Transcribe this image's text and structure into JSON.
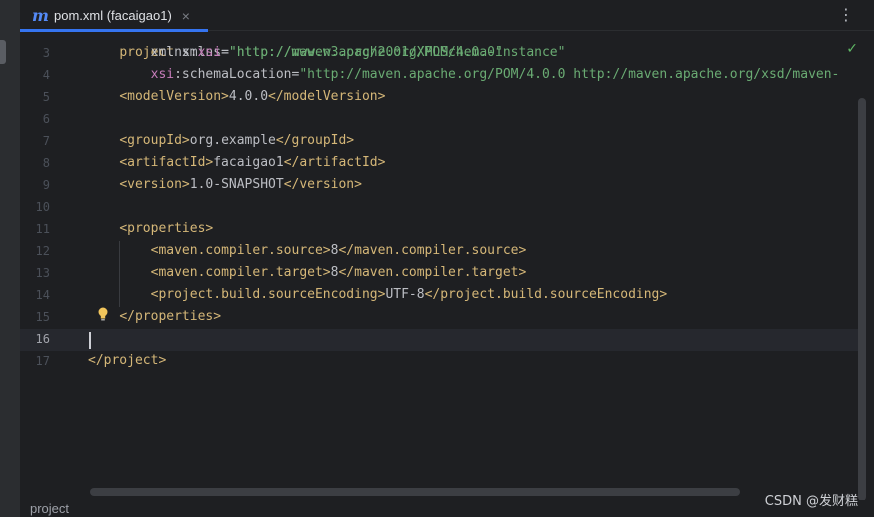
{
  "tab": {
    "icon": "maven-m-icon",
    "icon_glyph": "m",
    "title": "pom.xml (facaigao1)",
    "close_glyph": "×"
  },
  "toolbar": {
    "more_glyph": "⋮"
  },
  "status": {
    "check_glyph": "✓"
  },
  "editor": {
    "current_line": 16,
    "lines": [
      {
        "num": "3",
        "parts": [
          [
            "",
            "        "
          ],
          [
            "attr",
            "xmlns"
          ],
          [
            "",
            ":"
          ],
          [
            "ns",
            "xsi"
          ],
          [
            "",
            "="
          ],
          [
            "str",
            "\"http://www.w3.org/2001/XMLSchema-instance\""
          ]
        ]
      },
      {
        "num": "4",
        "parts": [
          [
            "",
            "        "
          ],
          [
            "ns",
            "xsi"
          ],
          [
            "attr",
            ":schemaLocation"
          ],
          [
            "",
            "="
          ],
          [
            "str",
            "\"http://maven.apache.org/POM/4.0.0 http://maven.apache.org/xsd/maven-"
          ]
        ]
      },
      {
        "num": "5",
        "parts": [
          [
            "",
            "    "
          ],
          [
            "tag",
            "<modelVersion>"
          ],
          [
            "txt",
            "4.0.0"
          ],
          [
            "tag",
            "</modelVersion>"
          ]
        ]
      },
      {
        "num": "6",
        "parts": []
      },
      {
        "num": "7",
        "parts": [
          [
            "",
            "    "
          ],
          [
            "tag",
            "<groupId>"
          ],
          [
            "txt",
            "org.example"
          ],
          [
            "tag",
            "</groupId>"
          ]
        ]
      },
      {
        "num": "8",
        "parts": [
          [
            "",
            "    "
          ],
          [
            "tag",
            "<artifactId>"
          ],
          [
            "txt",
            "facaigao1"
          ],
          [
            "tag",
            "</artifactId>"
          ]
        ]
      },
      {
        "num": "9",
        "parts": [
          [
            "",
            "    "
          ],
          [
            "tag",
            "<version>"
          ],
          [
            "txt",
            "1.0-SNAPSHOT"
          ],
          [
            "tag",
            "</version>"
          ]
        ]
      },
      {
        "num": "10",
        "parts": []
      },
      {
        "num": "11",
        "parts": [
          [
            "",
            "    "
          ],
          [
            "tag",
            "<properties>"
          ]
        ]
      },
      {
        "num": "12",
        "parts": [
          [
            "",
            "        "
          ],
          [
            "tag",
            "<maven.compiler.source>"
          ],
          [
            "txt",
            "8"
          ],
          [
            "tag",
            "</maven.compiler.source>"
          ]
        ]
      },
      {
        "num": "13",
        "parts": [
          [
            "",
            "        "
          ],
          [
            "tag",
            "<maven.compiler.target>"
          ],
          [
            "txt",
            "8"
          ],
          [
            "tag",
            "</maven.compiler.target>"
          ]
        ]
      },
      {
        "num": "14",
        "parts": [
          [
            "",
            "        "
          ],
          [
            "tag",
            "<project.build.sourceEncoding>"
          ],
          [
            "txt",
            "UTF-8"
          ],
          [
            "tag",
            "</project.build.sourceEncoding>"
          ]
        ]
      },
      {
        "num": "15",
        "parts": [
          [
            "",
            "    "
          ],
          [
            "tag",
            "</properties>"
          ]
        ]
      },
      {
        "num": "16",
        "parts": []
      },
      {
        "num": "17",
        "parts": [
          [
            "tag",
            "</project>"
          ]
        ]
      }
    ]
  },
  "statusbar": {
    "breadcrumb": "project"
  },
  "watermark": "CSDN @发财糕",
  "colors": {
    "tag": "#d5b778",
    "string": "#6aab73",
    "namespace": "#c77dbb",
    "accent": "#3574f0"
  }
}
